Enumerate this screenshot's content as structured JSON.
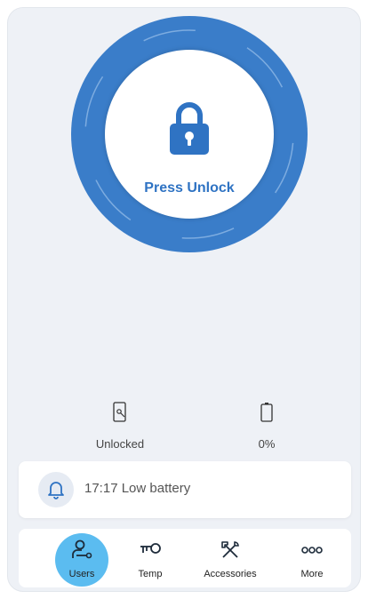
{
  "unlock": {
    "label": "Press Unlock",
    "ring_color": "#3a7dc9",
    "accent_color": "#2f73c3"
  },
  "status": {
    "lock_state": "Unlocked",
    "battery_level": "0%",
    "lock_icon": "phone-key-icon",
    "battery_icon": "battery-empty-icon"
  },
  "notification": {
    "icon": "bell-icon",
    "text": "17:17 Low battery"
  },
  "tabs": [
    {
      "label": "Users",
      "icon": "user-key-icon",
      "active": true
    },
    {
      "label": "Temp",
      "icon": "key-icon",
      "active": false
    },
    {
      "label": "Accessories",
      "icon": "tools-icon",
      "active": false
    },
    {
      "label": "More",
      "icon": "more-dots-icon",
      "active": false
    }
  ],
  "colors": {
    "background": "#eef1f6",
    "active_tab": "#5bbcf0"
  }
}
